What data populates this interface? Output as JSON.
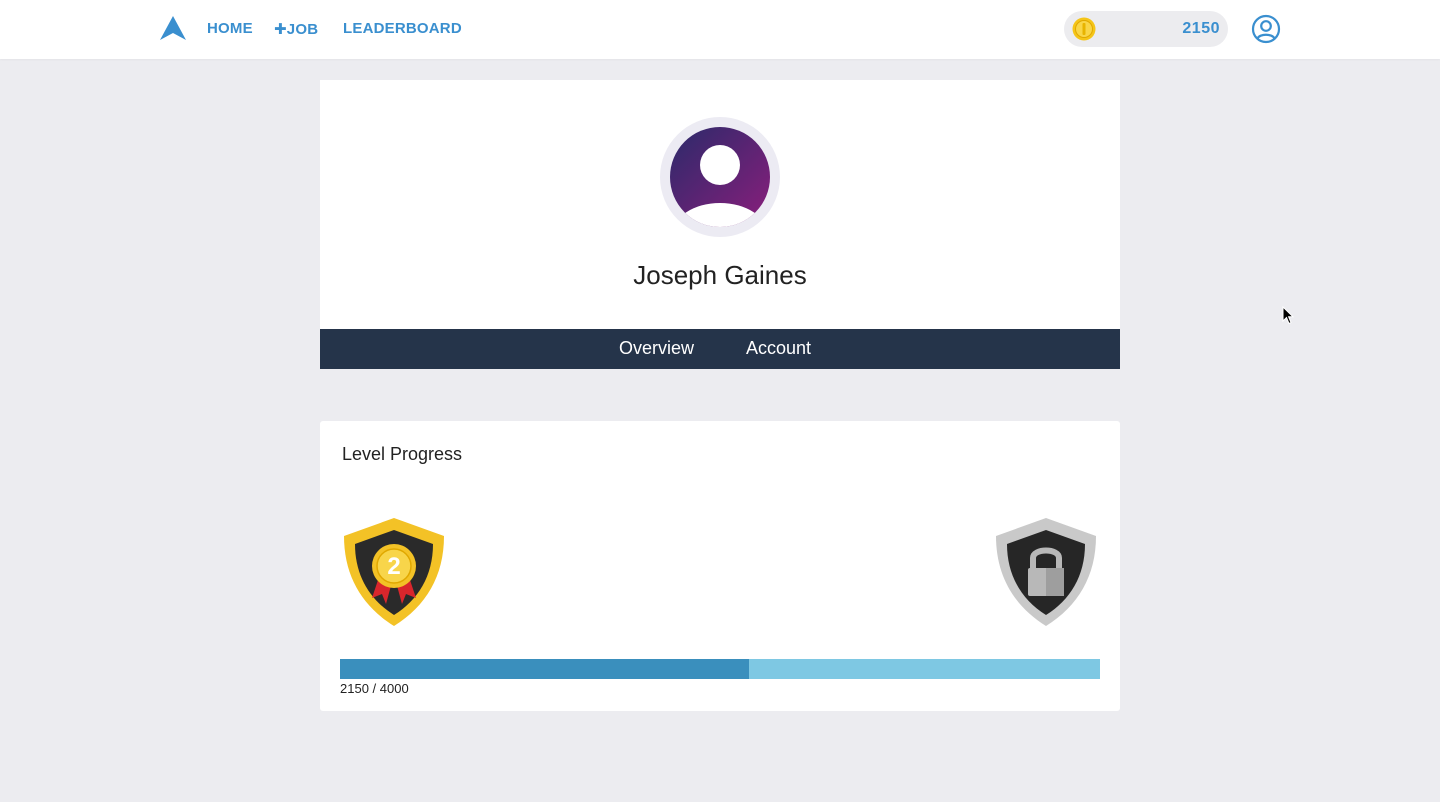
{
  "nav": {
    "home": "HOME",
    "job": "JOB",
    "job_plus": "✚",
    "leaderboard": "LEADERBOARD",
    "coins": "2150"
  },
  "profile": {
    "name": "Joseph Gaines",
    "tabs": [
      "Overview",
      "Account"
    ]
  },
  "level": {
    "title": "Level Progress",
    "current_level": "2",
    "progress_current": 2150,
    "progress_max": 4000,
    "progress_fraction": 0.5375,
    "progress_text": "2150 / 4000"
  },
  "colors": {
    "accent": "#3a8fcf",
    "tabbar": "#25344a",
    "progress_fill": "#3a8fbd",
    "progress_track": "#7ec8e3"
  }
}
